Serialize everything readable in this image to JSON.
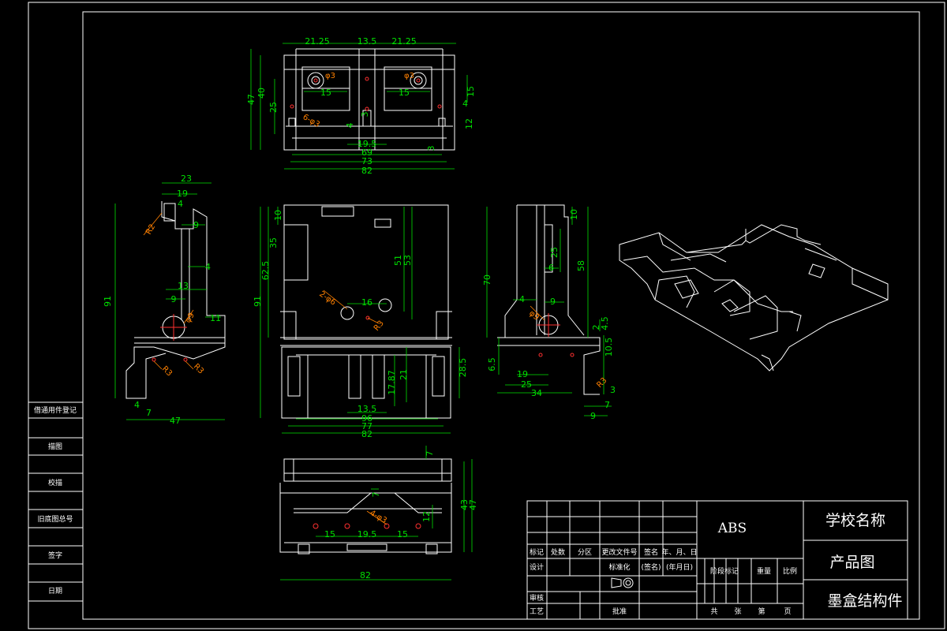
{
  "left_strip": {
    "labels": [
      "借通用件登记",
      "描图",
      "校描",
      "旧底图总号",
      "签字",
      "日期"
    ]
  },
  "title_block": {
    "material": "ABS",
    "school": "学校名称",
    "drawing_type": "产品图",
    "part_name": "墨盒结构件",
    "row_headers": [
      "标记",
      "处数",
      "分区",
      "更改文件号",
      "签名",
      "年、月、日"
    ],
    "design": "设计",
    "standardize": "标准化",
    "sign_paren": "(签名)",
    "date_paren": "(年月日)",
    "stage_mark": "阶段标记",
    "weight": "重量",
    "scale": "比例",
    "review": "审核",
    "process": "工艺",
    "approve": "批准",
    "total": "共",
    "sheets1": "张",
    "page": "第",
    "sheets2": "页"
  },
  "dimensions": {
    "top_view": [
      "21.25",
      "13.5",
      "21.25",
      "φ3",
      "φ3",
      "15",
      "15",
      "40",
      "47",
      "25",
      "15",
      "4",
      "12",
      "6-φ3",
      "4",
      "3",
      "19.5",
      "3",
      "69",
      "73",
      "82"
    ],
    "left_view": [
      "23",
      "19",
      "4",
      "R2",
      "9",
      "4",
      "13",
      "9",
      "91",
      "φ9",
      "11",
      "R3",
      "R3",
      "4",
      "7",
      "47"
    ],
    "front_view": [
      "10",
      "35",
      "62.5",
      "91",
      "51",
      "53",
      "2-φ6",
      "16",
      "R3",
      "17.87",
      "21",
      "28.5",
      "13.5",
      "96",
      "77",
      "82"
    ],
    "right_view": [
      "10",
      "70",
      "25",
      "6",
      "58",
      "4",
      "9",
      "φ9",
      "2",
      "4.5",
      "10.5",
      "6.5",
      "19",
      "25",
      "34",
      "3",
      "7",
      "9",
      "R3"
    ],
    "bottom_view": [
      "7",
      "7",
      "43",
      "47",
      "4-φ3",
      "12",
      "15",
      "19.5",
      "15",
      "82"
    ]
  }
}
